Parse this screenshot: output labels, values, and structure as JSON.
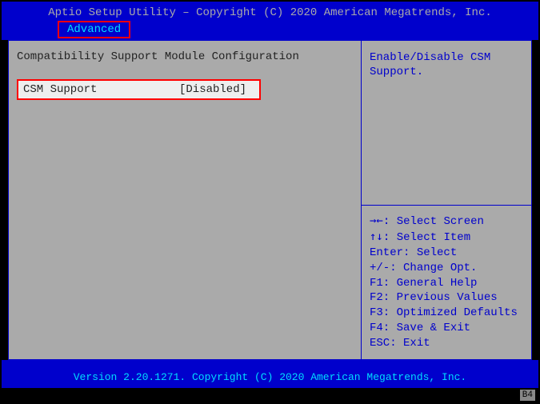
{
  "header": {
    "title": "Aptio Setup Utility – Copyright (C) 2020 American Megatrends, Inc.",
    "active_tab": "Advanced"
  },
  "main": {
    "section_title": "Compatibility Support Module Configuration",
    "options": [
      {
        "label": "CSM Support",
        "value": "[Disabled]"
      }
    ]
  },
  "help": {
    "text": "Enable/Disable CSM Support."
  },
  "keys": {
    "select_screen": {
      "glyph": "→←:",
      "label": " Select Screen"
    },
    "select_item": {
      "glyph": "↑↓:",
      "label": " Select Item"
    },
    "select": {
      "glyph": "Enter:",
      "label": " Select"
    },
    "change": {
      "glyph": "+/-:",
      "label": " Change Opt."
    },
    "help": {
      "glyph": "F1:",
      "label": " General Help"
    },
    "previous": {
      "glyph": "F2:",
      "label": " Previous Values"
    },
    "defaults": {
      "glyph": "F3:",
      "label": " Optimized Defaults"
    },
    "save": {
      "glyph": "F4:",
      "label": " Save & Exit"
    },
    "exit": {
      "glyph": "ESC:",
      "label": " Exit"
    }
  },
  "footer": {
    "text": "Version 2.20.1271. Copyright (C) 2020 American Megatrends, Inc."
  },
  "badge": "B4"
}
